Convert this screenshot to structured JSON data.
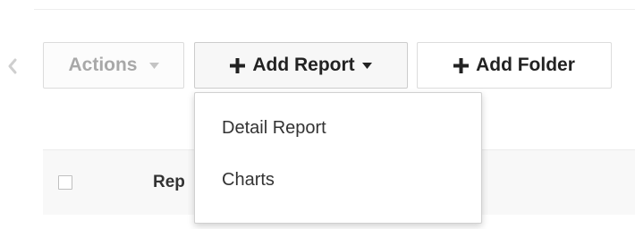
{
  "toolbar": {
    "actions_label": "Actions",
    "add_report_label": "Add Report",
    "add_folder_label": "Add Folder"
  },
  "add_report_menu": {
    "items": [
      {
        "label": "Detail Report"
      },
      {
        "label": "Charts"
      }
    ]
  },
  "table": {
    "header": {
      "report_column_label": "Rep"
    }
  },
  "icons": {
    "back": "chevron-left-icon",
    "actions_caret": "caret-down-icon",
    "add_report_plus": "plus-icon",
    "add_report_caret": "caret-down-icon",
    "add_folder_plus": "plus-icon"
  },
  "colors": {
    "disabled_text": "#a8a8a8",
    "primary_text": "#222222",
    "border": "#dcdcdc",
    "header_bg": "#f8f8f8"
  }
}
